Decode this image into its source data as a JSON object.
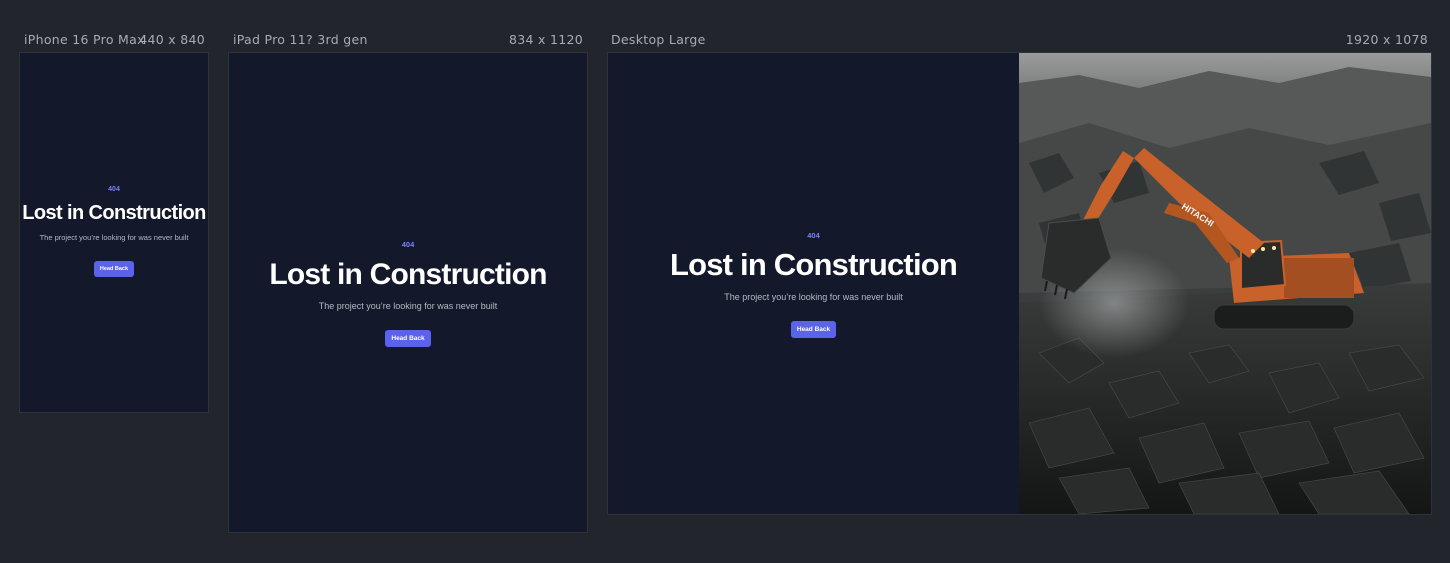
{
  "frames": [
    {
      "name": "iPhone 16 Pro Max",
      "size": "440 x 840",
      "page": {
        "error_code": "404",
        "heading": "Lost in Construction",
        "message": "The project you’re looking for was never built",
        "button_label": "Head Back"
      }
    },
    {
      "name": "iPad Pro 11? 3rd gen",
      "size": "834 x 1120",
      "page": {
        "error_code": "404",
        "heading": "Lost in Construction",
        "message": "The project you’re looking for was never built",
        "button_label": "Head Back"
      }
    },
    {
      "name": "Desktop Large",
      "size": "1920 x 1078",
      "page": {
        "error_code": "404",
        "heading": "Lost in Construction",
        "message": "The project you’re looking for was never built",
        "button_label": "Head Back"
      },
      "image": {
        "subject": "orange excavator in a dark rocky quarry",
        "brand_text": "HITACHI"
      }
    }
  ],
  "colors": {
    "canvas_bg": "#22252c",
    "page_bg": "#13182a",
    "accent": "#5b63ea",
    "code_text": "#7b80ff",
    "heading_text": "#ffffff",
    "body_text": "#b6bac4",
    "excavator": "#c8622a"
  }
}
